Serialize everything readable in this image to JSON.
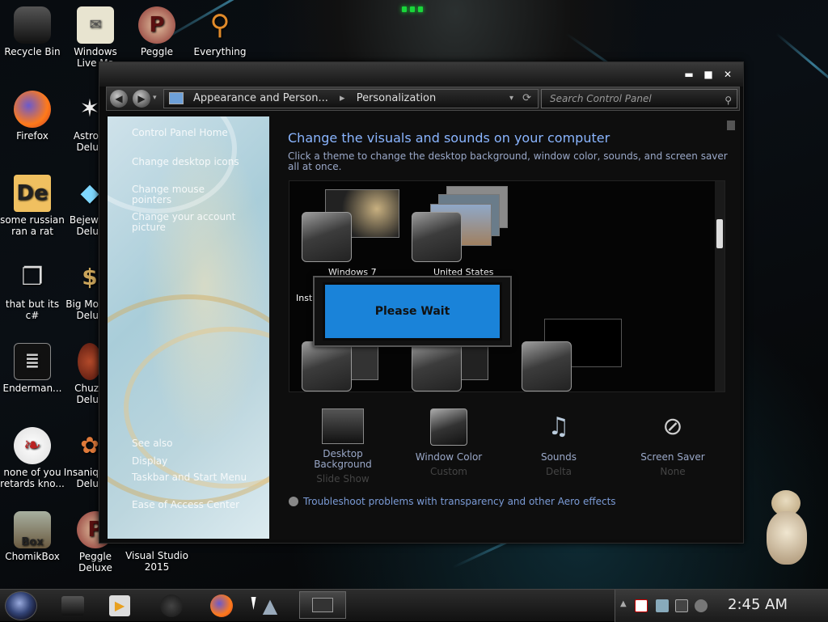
{
  "desktop": {
    "icons": [
      {
        "label": "Recycle Bin",
        "icon": "recycle-bin-icon"
      },
      {
        "label": "Windows Live Ma",
        "icon": "windows-live-mail-icon"
      },
      {
        "label": "Peggle",
        "icon": "peggle-icon"
      },
      {
        "label": "Everything",
        "icon": "everything-search-icon"
      },
      {
        "label": "Firefox",
        "icon": "firefox-icon"
      },
      {
        "label": "Astro Delu",
        "icon": "astro-game-icon"
      },
      {
        "label": "some russian ran a rat",
        "icon": "de-app-icon"
      },
      {
        "label": "Bejew Delu",
        "icon": "bejeweled-icon"
      },
      {
        "label": "that but its c#",
        "icon": "stacked-windows-icon"
      },
      {
        "label": "Big Mo Delu",
        "icon": "money-bag-icon"
      },
      {
        "label": "Enderman...",
        "icon": "console-icon"
      },
      {
        "label": "Chuz Delu",
        "icon": "chuzzle-icon"
      },
      {
        "label": "none of you retards kno...",
        "icon": "dino-icon"
      },
      {
        "label": "Insaniq Delu",
        "icon": "insaniquarium-icon"
      },
      {
        "label": "ChomikBox",
        "icon": "chomikbox-icon"
      },
      {
        "label": "Peggle Deluxe",
        "icon": "peggle-deluxe-icon"
      },
      {
        "label": "Visual Studio 2015",
        "icon": "visual-studio-icon"
      }
    ]
  },
  "window": {
    "controls": {
      "minimize": "▬",
      "maximize": "■",
      "close": "✕"
    },
    "breadcrumb": [
      "Appearance and Person...",
      "Personalization"
    ],
    "search_placeholder": "Search Control Panel",
    "left_pane": {
      "home": "Control Panel Home",
      "tasks": [
        "Change desktop icons",
        "Change mouse pointers",
        "Change your account picture"
      ],
      "see_also_title": "See also",
      "see_also": [
        "Display",
        "Taskbar and Start Menu",
        "Ease of Access Center"
      ]
    },
    "heading": "Change the visuals and sounds on your computer",
    "subheading": "Click a theme to change the desktop background, window color, sounds, and screen saver all at once.",
    "themes": {
      "labels": [
        "Windows 7",
        "United States"
      ],
      "partial_label": "Inst"
    },
    "dialog": {
      "text": "Please Wait"
    },
    "bottom_items": [
      {
        "title": "Desktop Background",
        "subtitle": "Slide Show",
        "icon": "desktop-background-icon"
      },
      {
        "title": "Window Color",
        "subtitle": "Custom",
        "icon": "window-color-icon"
      },
      {
        "title": "Sounds",
        "subtitle": "Delta",
        "icon": "sounds-icon"
      },
      {
        "title": "Screen Saver",
        "subtitle": "None",
        "icon": "screen-saver-icon"
      }
    ],
    "troubleshoot": "Troubleshoot problems with transparency and other Aero effects"
  },
  "taskbar": {
    "clock": "2:45 AM",
    "colors": {
      "accent": "#1a83d9",
      "glow": "#19d63a"
    }
  }
}
